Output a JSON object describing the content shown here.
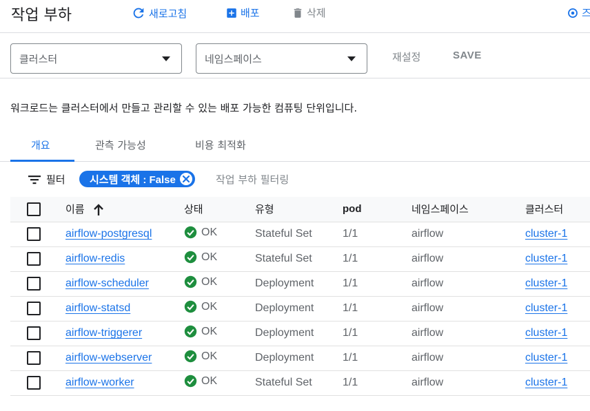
{
  "header": {
    "title": "작업 부하",
    "refresh_label": "새로고침",
    "deploy_label": "배포",
    "delete_label": "삭제",
    "right_label": "즈"
  },
  "filters": {
    "cluster_placeholder": "클러스터",
    "namespace_placeholder": "네임스페이스",
    "reset_label": "재설정",
    "save_label": "SAVE"
  },
  "description": "워크로드는 클러스터에서 만들고 관리할 수 있는 배포 가능한 컴퓨팅 단위입니다.",
  "tabs": [
    {
      "label": "개요"
    },
    {
      "label": "관측 가능성"
    },
    {
      "label": "비용 최적화"
    }
  ],
  "filterbar": {
    "label": "필터",
    "chip": "시스템 객체 : False",
    "placeholder": "작업 부하 필터링"
  },
  "table": {
    "columns": [
      "이름",
      "상태",
      "유형",
      "pod",
      "네임스페이스",
      "클러스터"
    ],
    "rows": [
      {
        "name": "airflow-postgresql",
        "status": "OK",
        "type": "Stateful Set",
        "pods": "1/1",
        "namespace": "airflow",
        "cluster": "cluster-1"
      },
      {
        "name": "airflow-redis",
        "status": "OK",
        "type": "Stateful Set",
        "pods": "1/1",
        "namespace": "airflow",
        "cluster": "cluster-1"
      },
      {
        "name": "airflow-scheduler",
        "status": "OK",
        "type": "Deployment",
        "pods": "1/1",
        "namespace": "airflow",
        "cluster": "cluster-1"
      },
      {
        "name": "airflow-statsd",
        "status": "OK",
        "type": "Deployment",
        "pods": "1/1",
        "namespace": "airflow",
        "cluster": "cluster-1"
      },
      {
        "name": "airflow-triggerer",
        "status": "OK",
        "type": "Deployment",
        "pods": "1/1",
        "namespace": "airflow",
        "cluster": "cluster-1"
      },
      {
        "name": "airflow-webserver",
        "status": "OK",
        "type": "Deployment",
        "pods": "1/1",
        "namespace": "airflow",
        "cluster": "cluster-1"
      },
      {
        "name": "airflow-worker",
        "status": "OK",
        "type": "Stateful Set",
        "pods": "1/1",
        "namespace": "airflow",
        "cluster": "cluster-1"
      }
    ]
  },
  "colors": {
    "accent": "#1a73e8",
    "ok_green": "#1e8e3e"
  }
}
